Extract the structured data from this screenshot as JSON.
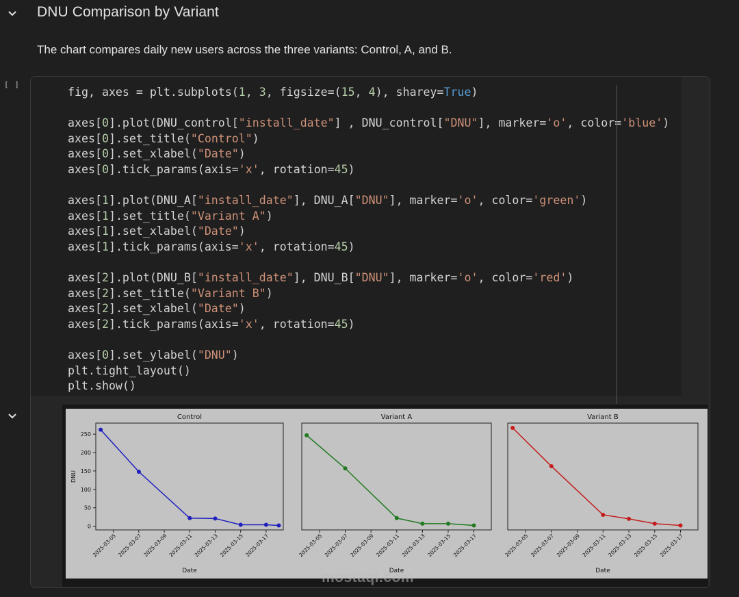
{
  "markdown": {
    "title": "DNU Comparison by Variant",
    "text": "The chart compares daily new users across the three variants: Control, A, and B."
  },
  "cell": {
    "exec_count": "[ ]"
  },
  "code_lines": [
    "fig, axes = plt.subplots(1, 3, figsize=(15, 4), sharey=True)",
    "",
    "axes[0].plot(DNU_control[\"install_date\"] , DNU_control[\"DNU\"], marker='o', color='blue')",
    "axes[0].set_title(\"Control\")",
    "axes[0].set_xlabel(\"Date\")",
    "axes[0].tick_params(axis='x', rotation=45)",
    "",
    "axes[1].plot(DNU_A[\"install_date\"], DNU_A[\"DNU\"], marker='o', color='green')",
    "axes[1].set_title(\"Variant A\")",
    "axes[1].set_xlabel(\"Date\")",
    "axes[1].tick_params(axis='x', rotation=45)",
    "",
    "axes[2].plot(DNU_B[\"install_date\"], DNU_B[\"DNU\"], marker='o', color='red')",
    "axes[2].set_title(\"Variant B\")",
    "axes[2].set_xlabel(\"Date\")",
    "axes[2].tick_params(axis='x', rotation=45)",
    "",
    "axes[0].set_ylabel(\"DNU\")",
    "plt.tight_layout()",
    "plt.show()"
  ],
  "colors": {
    "background": "#1f1f1f",
    "figure_bg": "#c3c3c3",
    "string": "#ce9178",
    "number": "#b5cea8",
    "keyword": "#569cd6"
  },
  "icons": {
    "collapse": "chevron-down-icon",
    "output_toggle": "chevron-down-icon"
  },
  "watermark": "mostaql.com",
  "chart_data": [
    {
      "type": "line",
      "title": "Control",
      "xlabel": "Date",
      "ylabel": "DNU",
      "color": "#1f1fbf",
      "marker": "o",
      "x": [
        "2025-03-04",
        "2025-03-07",
        "2025-03-11",
        "2025-03-13",
        "2025-03-15",
        "2025-03-17",
        "2025-03-18"
      ],
      "y": [
        262,
        148,
        22,
        21,
        4,
        4,
        2
      ],
      "xticks": [
        "2025-03-05",
        "2025-03-07",
        "2025-03-09",
        "2025-03-11",
        "2025-03-13",
        "2025-03-15",
        "2025-03-17"
      ],
      "yticks": [
        0,
        50,
        100,
        150,
        200,
        250
      ],
      "ylim": [
        -10,
        280
      ],
      "grid": false
    },
    {
      "type": "line",
      "title": "Variant A",
      "xlabel": "Date",
      "ylabel": "",
      "color": "#217a21",
      "marker": "o",
      "x": [
        "2025-03-04",
        "2025-03-07",
        "2025-03-11",
        "2025-03-13",
        "2025-03-15",
        "2025-03-17"
      ],
      "y": [
        247,
        157,
        22,
        7,
        7,
        2
      ],
      "xticks": [
        "2025-03-05",
        "2025-03-07",
        "2025-03-09",
        "2025-03-11",
        "2025-03-13",
        "2025-03-15",
        "2025-03-17"
      ],
      "yticks": [],
      "ylim": [
        -10,
        280
      ],
      "grid": false
    },
    {
      "type": "line",
      "title": "Variant B",
      "xlabel": "Date",
      "ylabel": "",
      "color": "#c41c1c",
      "marker": "o",
      "x": [
        "2025-03-04",
        "2025-03-07",
        "2025-03-11",
        "2025-03-13",
        "2025-03-15",
        "2025-03-17"
      ],
      "y": [
        267,
        163,
        31,
        20,
        7,
        2
      ],
      "xticks": [
        "2025-03-05",
        "2025-03-07",
        "2025-03-09",
        "2025-03-11",
        "2025-03-13",
        "2025-03-15",
        "2025-03-17"
      ],
      "yticks": [],
      "ylim": [
        -10,
        280
      ],
      "grid": false
    }
  ]
}
